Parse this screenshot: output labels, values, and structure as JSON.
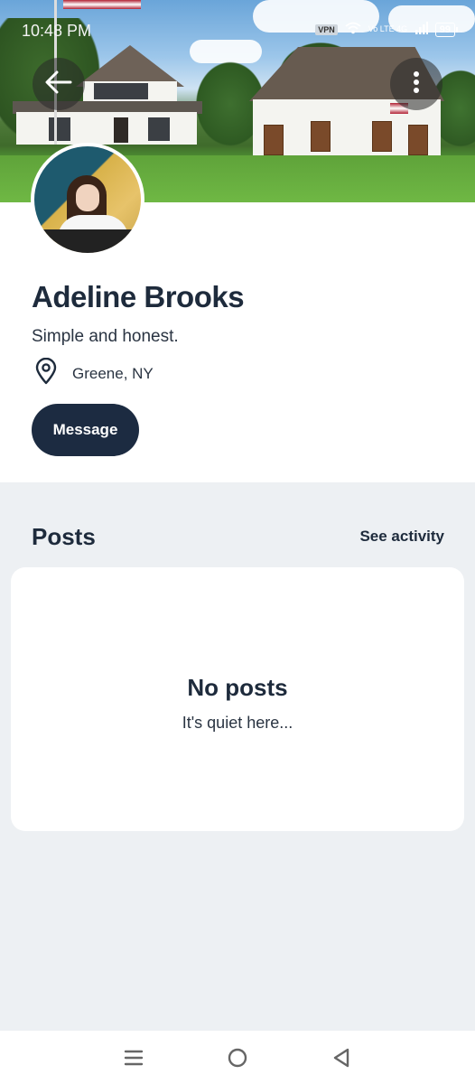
{
  "status_bar": {
    "time": "10:48 PM",
    "vpn": "VPN",
    "network": "Vo LTE 4G",
    "battery": "99"
  },
  "cover": {
    "description_icon": "house-cover-photo"
  },
  "profile": {
    "name": "Adeline Brooks",
    "bio": "Simple and honest.",
    "location": "Greene, NY",
    "message_label": "Message"
  },
  "posts": {
    "title": "Posts",
    "see_activity": "See activity",
    "empty_title": "No posts",
    "empty_subtitle": "It's quiet here..."
  },
  "colors": {
    "primary_dark": "#1c2b41",
    "background": "#edf0f3",
    "card": "#ffffff"
  },
  "nav": {
    "icons": [
      "menu-icon",
      "home-circle-icon",
      "back-triangle-icon"
    ]
  }
}
